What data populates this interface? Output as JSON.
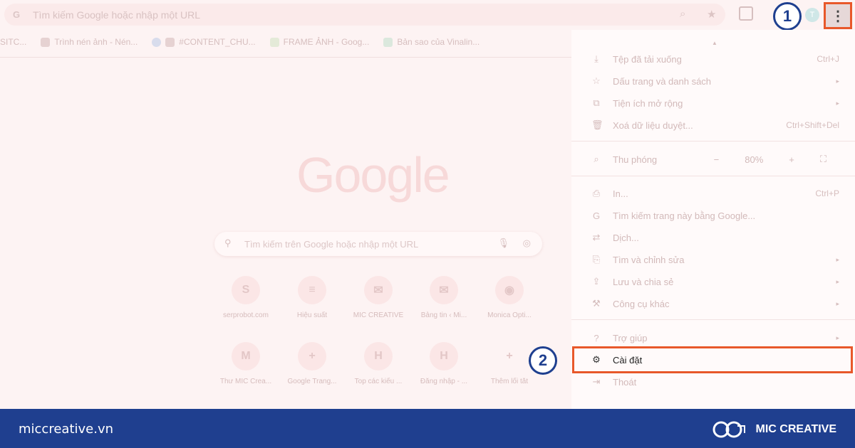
{
  "omnibox": {
    "placeholder": "Tìm kiếm Google hoặc nhập một URL",
    "profile_initial": "T"
  },
  "bookmarks": [
    {
      "label": "SITC..."
    },
    {
      "label": "Trình nén ảnh - Nén..."
    },
    {
      "label": "#CONTENT_CHU..."
    },
    {
      "label": "FRAME ẢNH - Goog..."
    },
    {
      "label": "Bản sao của Vinalin..."
    }
  ],
  "page": {
    "logo": "Google",
    "search_placeholder": "Tìm kiếm trên Google hoặc nhập một URL",
    "shortcuts": [
      {
        "icon_text": "S",
        "label": "serprobot.com"
      },
      {
        "icon_text": "≡",
        "label": "Hiệu suất"
      },
      {
        "icon_text": "✉",
        "label": "MIC CREATIVE"
      },
      {
        "icon_text": "✉",
        "label": "Bảng tin ‹ Mi..."
      },
      {
        "icon_text": "◉",
        "label": "Monica Opti..."
      },
      {
        "icon_text": "M",
        "label": "Thư MIC Crea..."
      },
      {
        "icon_text": "+",
        "label": "Google Trang..."
      },
      {
        "icon_text": "H",
        "label": "Top các kiểu ..."
      },
      {
        "icon_text": "H",
        "label": "Đăng nhập - ..."
      },
      {
        "icon_text": "+",
        "label": "Thêm lối tắt"
      }
    ]
  },
  "menu": {
    "items": [
      {
        "icon": "⤓",
        "label": "Tệp đã tải xuống",
        "shortcut": "Ctrl+J"
      },
      {
        "icon": "☆",
        "label": "Dấu trang và danh sách",
        "shortcut": "▸"
      },
      {
        "icon": "⧉",
        "label": "Tiện ích mở rộng",
        "shortcut": "▸"
      },
      {
        "icon": "🗑",
        "label": "Xoá dữ liệu duyệt...",
        "shortcut": "Ctrl+Shift+Del"
      }
    ],
    "zoom": {
      "icon": "⌕",
      "label": "Thu phóng",
      "minus": "−",
      "value": "80%",
      "plus": "+",
      "fullscreen": "⛶"
    },
    "items2": [
      {
        "icon": "⎙",
        "label": "In...",
        "shortcut": "Ctrl+P"
      },
      {
        "icon": "G",
        "label": "Tìm kiếm trang này bằng Google...",
        "shortcut": ""
      },
      {
        "icon": "⇄",
        "label": "Dịch...",
        "shortcut": ""
      },
      {
        "icon": "⎘",
        "label": "Tìm và chỉnh sửa",
        "shortcut": "▸"
      },
      {
        "icon": "⇪",
        "label": "Lưu và chia sẻ",
        "shortcut": "▸"
      },
      {
        "icon": "⚒",
        "label": "Công cụ khác",
        "shortcut": "▸"
      }
    ],
    "help": {
      "icon": "?",
      "label": "Trợ giúp",
      "shortcut": "▸"
    },
    "settings": {
      "icon": "⚙",
      "label": "Cài đặt"
    },
    "exit": {
      "icon": "⇥",
      "label": "Thoát"
    }
  },
  "annotations": {
    "step1": "1",
    "step2": "2"
  },
  "footer": {
    "url": "miccreative.vn",
    "brand": "MIC CREATIVE"
  },
  "colors": {
    "highlight": "#e8582a",
    "footer_bg": "#1f3f8f"
  }
}
